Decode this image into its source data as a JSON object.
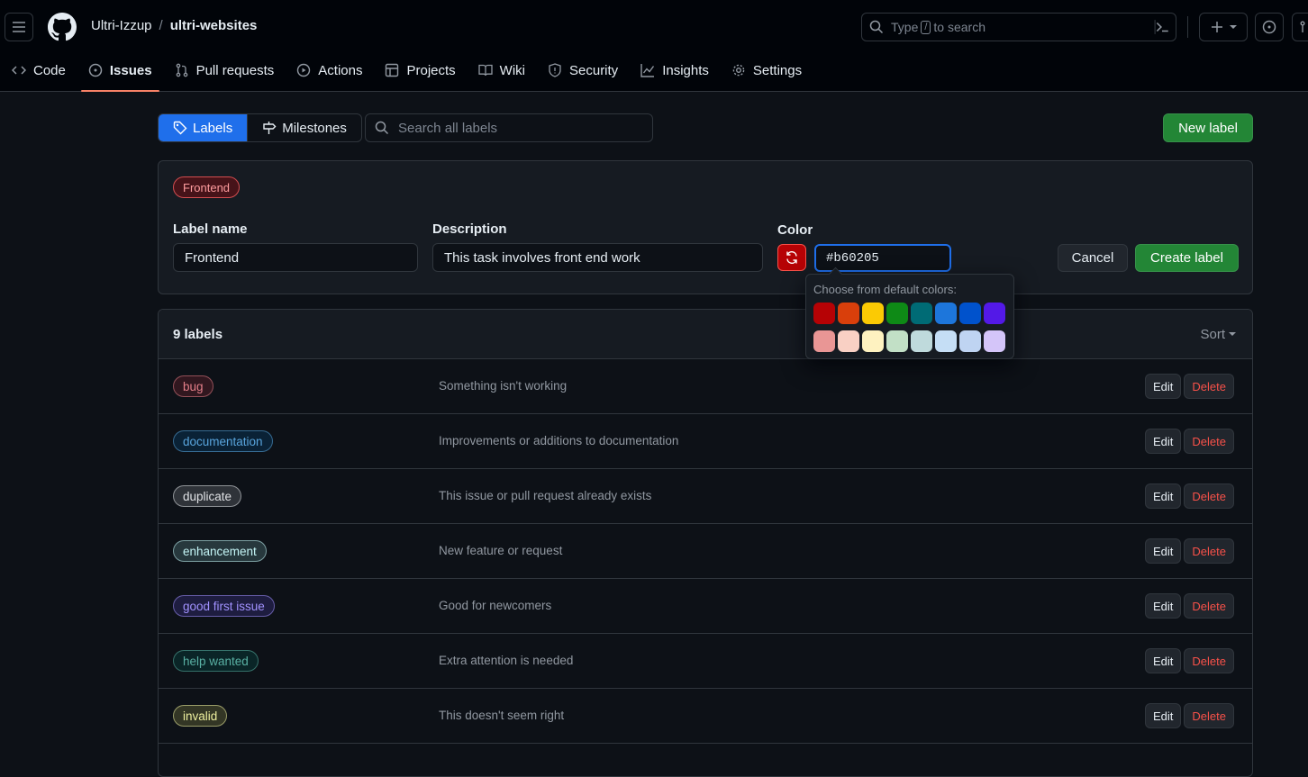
{
  "header": {
    "owner": "Ultri-Izzup",
    "separator": "/",
    "repo": "ultri-websites",
    "search_prefix": "Type",
    "search_key": "/",
    "search_suffix": "to search"
  },
  "repo_nav": [
    {
      "label": "Code",
      "icon": "code-icon",
      "active": false
    },
    {
      "label": "Issues",
      "icon": "issue-opened-icon",
      "active": true
    },
    {
      "label": "Pull requests",
      "icon": "git-pull-request-icon",
      "active": false
    },
    {
      "label": "Actions",
      "icon": "play-icon",
      "active": false
    },
    {
      "label": "Projects",
      "icon": "table-icon",
      "active": false
    },
    {
      "label": "Wiki",
      "icon": "book-icon",
      "active": false
    },
    {
      "label": "Security",
      "icon": "shield-icon",
      "active": false
    },
    {
      "label": "Insights",
      "icon": "graph-icon",
      "active": false
    },
    {
      "label": "Settings",
      "icon": "gear-icon",
      "active": false
    }
  ],
  "subnav": {
    "labels": "Labels",
    "milestones": "Milestones",
    "search_placeholder": "Search all labels",
    "new_label": "New label"
  },
  "form": {
    "preview": "Frontend",
    "name_label": "Label name",
    "name_value": "Frontend",
    "description_label": "Description",
    "description_value": "This task involves front end work",
    "color_label": "Color",
    "color_value": "#b60205",
    "cancel": "Cancel",
    "create": "Create label"
  },
  "color_picker": {
    "title": "Choose from default colors:",
    "row1": [
      "#b60205",
      "#d93f0b",
      "#fbca04",
      "#0e8a16",
      "#006b75",
      "#1d76db",
      "#0052cc",
      "#5319e7"
    ],
    "row2": [
      "#e99695",
      "#f9d0c4",
      "#fef2c0",
      "#c2e0c6",
      "#bfdadc",
      "#c5def5",
      "#bfd4f2",
      "#d4c5f9"
    ]
  },
  "list": {
    "count": "9 labels",
    "sort": "Sort",
    "edit": "Edit",
    "delete": "Delete",
    "labels": [
      {
        "name": "bug",
        "description": "Something isn't working",
        "color": "#d73a4a"
      },
      {
        "name": "documentation",
        "description": "Improvements or additions to documentation",
        "color": "#0075ca"
      },
      {
        "name": "duplicate",
        "description": "This issue or pull request already exists",
        "color": "#cfd3d7"
      },
      {
        "name": "enhancement",
        "description": "New feature or request",
        "color": "#a2eeef"
      },
      {
        "name": "good first issue",
        "description": "Good for newcomers",
        "color": "#7057ff"
      },
      {
        "name": "help wanted",
        "description": "Extra attention is needed",
        "color": "#008672"
      },
      {
        "name": "invalid",
        "description": "This doesn't seem right",
        "color": "#e4e669"
      }
    ]
  }
}
